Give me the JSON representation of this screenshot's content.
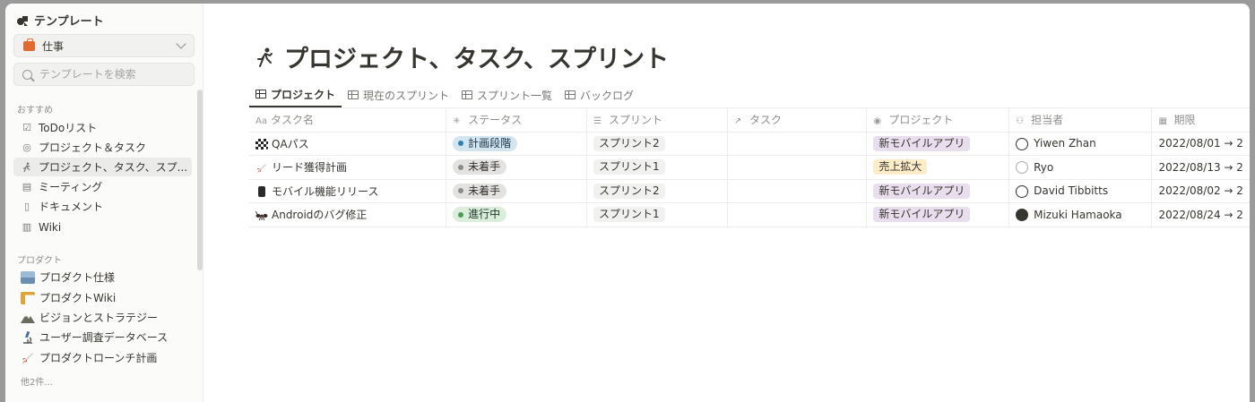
{
  "sidebar": {
    "title": "テンプレート",
    "category": "仕事",
    "search_placeholder": "テンプレートを検索",
    "recommended_label": "おすすめ",
    "recommended": [
      {
        "label": "ToDoリスト",
        "icon": "checkbox-icon"
      },
      {
        "label": "プロジェクト＆タスク",
        "icon": "target-icon"
      },
      {
        "label": "プロジェクト、タスク、スプ...",
        "icon": "runner-icon"
      },
      {
        "label": "ミーティング",
        "icon": "calendar-icon"
      },
      {
        "label": "ドキュメント",
        "icon": "document-icon"
      },
      {
        "label": "Wiki",
        "icon": "book-icon"
      }
    ],
    "product_label": "プロダクト",
    "product": [
      {
        "label": "プロダクト仕様",
        "icon": "ship-emoji"
      },
      {
        "label": "プロダクトWiki",
        "icon": "crane-emoji"
      },
      {
        "label": "ビジョンとストラテジー",
        "icon": "mountain-emoji"
      },
      {
        "label": "ユーザー調査データベース",
        "icon": "microscope-emoji"
      },
      {
        "label": "プロダクトローンチ計画",
        "icon": "rocket-emoji"
      }
    ],
    "more_label": "他2件..."
  },
  "page": {
    "title": "プロジェクト、タスク、スプリント",
    "title_icon": "runner-icon"
  },
  "tabs": [
    "プロジェクト",
    "現在のスプリント",
    "スプリント一覧",
    "バックログ"
  ],
  "table": {
    "columns": [
      {
        "icon": "Aa",
        "label": "タスク名"
      },
      {
        "icon": "status-icon",
        "label": "ステータス"
      },
      {
        "icon": "list-icon",
        "label": "スプリント"
      },
      {
        "icon": "relation-icon",
        "label": "タスク"
      },
      {
        "icon": "select-icon",
        "label": "プロジェクト"
      },
      {
        "icon": "people-icon",
        "label": "担当者"
      },
      {
        "icon": "date-icon",
        "label": "期限"
      }
    ],
    "rows": [
      {
        "name": "QAパス",
        "emoji": "checkered-flag",
        "status": "計画段階",
        "sprint": "スプリント2",
        "task": "",
        "project": "新モバイルアプリ",
        "assignee": "Yiwen Zhan",
        "due": "2022/08/01 → 2"
      },
      {
        "name": "リード獲得計画",
        "emoji": "rocket",
        "status": "未着手",
        "sprint": "スプリント1",
        "task": "",
        "project": "売上拡大",
        "assignee": "Ryo",
        "due": "2022/08/13 → 2"
      },
      {
        "name": "モバイル機能リリース",
        "emoji": "mobile-phone",
        "status": "未着手",
        "sprint": "スプリント2",
        "task": "",
        "project": "新モバイルアプリ",
        "assignee": "David Tibbitts",
        "due": "2022/08/02 → 2"
      },
      {
        "name": "Androidのバグ修正",
        "emoji": "ant",
        "status": "進行中",
        "sprint": "スプリント1",
        "task": "",
        "project": "新モバイルアプリ",
        "assignee": "Mizuki Hamaoka",
        "due": "2022/08/24 → 2"
      }
    ]
  },
  "colors": {
    "status_planning_bg": "#d3e5ef",
    "status_planning_dot": "#2f7fb6",
    "status_todo_bg": "#e3e2e0",
    "status_todo_dot": "#8c8b88",
    "status_progress_bg": "#dbeddb",
    "status_progress_dot": "#4e9a5b",
    "project_mobile_bg": "#e8deee",
    "project_sales_bg": "#fdecc8",
    "sprint_bg": "#f1f1ef"
  }
}
